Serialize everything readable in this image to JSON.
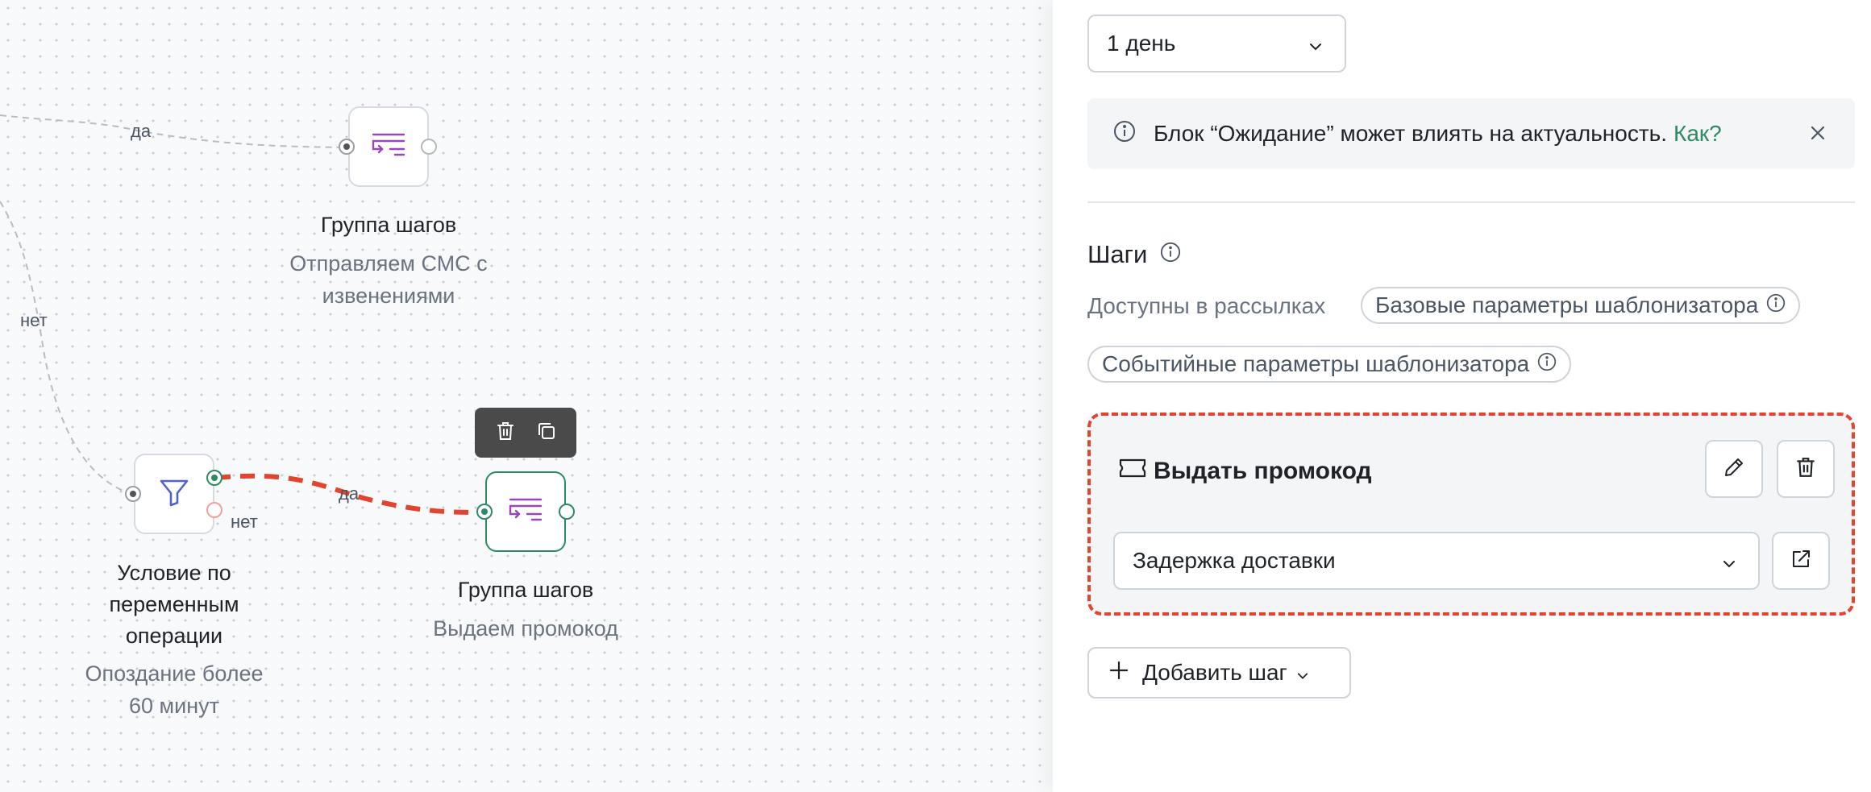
{
  "canvas": {
    "edge_labels": {
      "yes_top": "да",
      "no_left": "нет",
      "yes_bottom": "да",
      "no_bottom": "нет"
    },
    "nodes": {
      "group_sms": {
        "title": "Группа шагов",
        "subtitle_line1": "Отправляем СМС с",
        "subtitle_line2": "извенениями"
      },
      "condition": {
        "title_line1": "Условие по",
        "title_line2": "переменным",
        "title_line3": "операции",
        "subtitle_line1": "Опоздание более",
        "subtitle_line2": "60 минут"
      },
      "group_promo": {
        "title": "Группа шагов",
        "subtitle": "Выдаем промокод"
      }
    },
    "colors": {
      "selected": "#2e8a63",
      "highlight_edge": "#e2442f",
      "group_icon": "#9b46b6",
      "filter_icon": "#4f63c9"
    }
  },
  "panel": {
    "delay_select": {
      "value": "1 день"
    },
    "info_banner": {
      "message": "Блок “Ожидание” может влиять на актуальность.",
      "link": "Как?"
    },
    "steps_section": {
      "title": "Шаги",
      "available_label": "Доступны в рассылках",
      "chips": [
        "Базовые параметры шаблонизатора",
        "Событийные параметры шаблонизатора"
      ]
    },
    "step_card": {
      "title": "Выдать промокод",
      "select_value": "Задержка доставки",
      "border_color": "#e2442f"
    },
    "add_step_label": "Добавить шаг"
  }
}
